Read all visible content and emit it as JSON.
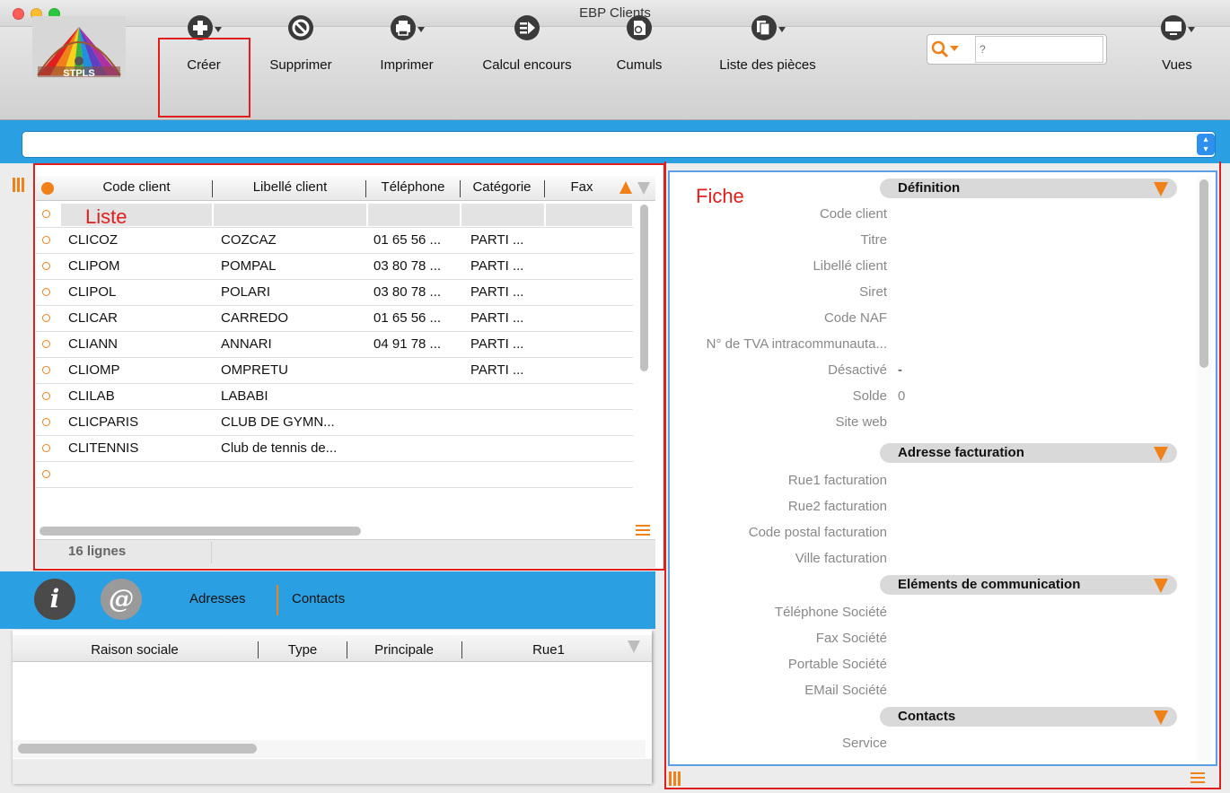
{
  "window": {
    "title": "EBP Clients"
  },
  "colors": {
    "accent": "#2a9fe2",
    "orange": "#f08018",
    "annotation_red": "#e01e1e"
  },
  "toolbar": {
    "logo_text": "STPLS",
    "buttons": [
      {
        "label": "Créer",
        "icon": "plus-circle-icon"
      },
      {
        "label": "Supprimer",
        "icon": "no-entry-icon"
      },
      {
        "label": "Imprimer",
        "icon": "printer-icon"
      },
      {
        "label": "Calcul encours",
        "icon": "arrow-circle-icon"
      },
      {
        "label": "Cumuls",
        "icon": "document-circle-icon"
      },
      {
        "label": "Liste des pièces",
        "icon": "documents-icon"
      }
    ],
    "search_placeholder": "?",
    "views_label": "Vues"
  },
  "list": {
    "annotation": "Liste",
    "columns": [
      "Code client",
      "Libellé client",
      "Téléphone",
      "Catégorie",
      "Fax"
    ],
    "rows": [
      {
        "code": "",
        "libelle": "",
        "telephone": "",
        "categorie": "",
        "fax": ""
      },
      {
        "code": "CLICOZ",
        "libelle": "COZCAZ",
        "telephone": "01 65 56 ...",
        "categorie": "PARTI ...",
        "fax": ""
      },
      {
        "code": "CLIPOM",
        "libelle": "POMPAL",
        "telephone": "03 80 78 ...",
        "categorie": "PARTI ...",
        "fax": ""
      },
      {
        "code": "CLIPOL",
        "libelle": "POLARI",
        "telephone": "03 80 78 ...",
        "categorie": "PARTI ...",
        "fax": ""
      },
      {
        "code": "CLICAR",
        "libelle": "CARREDO",
        "telephone": "01 65 56 ...",
        "categorie": "PARTI ...",
        "fax": ""
      },
      {
        "code": "CLIANN",
        "libelle": "ANNARI",
        "telephone": "04 91 78 ...",
        "categorie": "PARTI ...",
        "fax": ""
      },
      {
        "code": "CLIOMP",
        "libelle": "OMPRETU",
        "telephone": "",
        "categorie": "PARTI ...",
        "fax": ""
      },
      {
        "code": "CLILAB",
        "libelle": "LABABI",
        "telephone": "",
        "categorie": "",
        "fax": ""
      },
      {
        "code": "CLICPARIS",
        "libelle": "CLUB DE GYMN...",
        "telephone": "",
        "categorie": "",
        "fax": ""
      },
      {
        "code": "CLITENNIS",
        "libelle": "Club de tennis de...",
        "telephone": "",
        "categorie": "",
        "fax": ""
      }
    ],
    "count_label": "16 lignes"
  },
  "detail_tabs": {
    "info_icon": "i",
    "at_icon": "@",
    "tabs": [
      "Adresses",
      "Contacts"
    ]
  },
  "addresses_table": {
    "columns": [
      "Raison sociale",
      "Type",
      "Principale",
      "Rue1"
    ]
  },
  "fiche": {
    "annotation": "Fiche",
    "sections": [
      {
        "title": "Définition",
        "fields": [
          {
            "label": "Code client",
            "value": ""
          },
          {
            "label": "Titre",
            "value": ""
          },
          {
            "label": "Libellé client",
            "value": ""
          },
          {
            "label": "Siret",
            "value": ""
          },
          {
            "label": "Code NAF",
            "value": ""
          },
          {
            "label": "N° de TVA intracommunauta...",
            "value": ""
          },
          {
            "label": "Désactivé",
            "value": "-"
          },
          {
            "label": "Solde",
            "value": "0"
          },
          {
            "label": "Site web",
            "value": ""
          }
        ]
      },
      {
        "title": "Adresse facturation",
        "fields": [
          {
            "label": "Rue1 facturation",
            "value": ""
          },
          {
            "label": "Rue2 facturation",
            "value": ""
          },
          {
            "label": "Code postal facturation",
            "value": ""
          },
          {
            "label": "Ville facturation",
            "value": ""
          }
        ]
      },
      {
        "title": "Eléments de communication",
        "fields": [
          {
            "label": "Téléphone Société",
            "value": ""
          },
          {
            "label": "Fax Société",
            "value": ""
          },
          {
            "label": "Portable Société",
            "value": ""
          },
          {
            "label": "EMail Société",
            "value": ""
          }
        ]
      },
      {
        "title": "Contacts",
        "fields": [
          {
            "label": "Service",
            "value": ""
          }
        ]
      }
    ]
  }
}
